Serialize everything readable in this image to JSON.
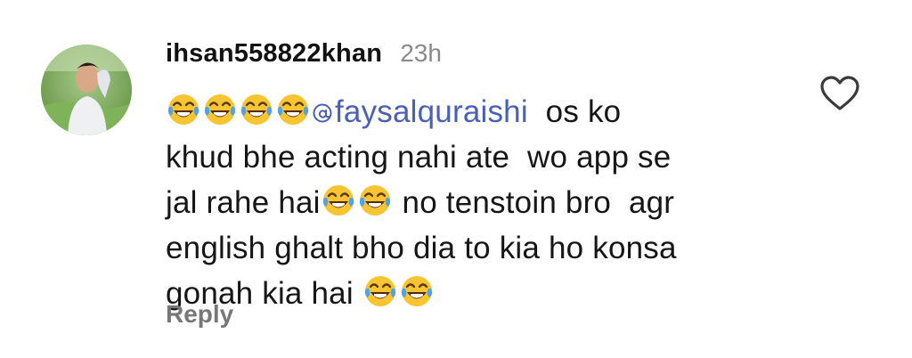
{
  "comment": {
    "username": "ihsan558822khan",
    "timestamp": "23h",
    "mention": "faysalquraishi",
    "lines": [
      [
        "emoji",
        "emoji",
        "emoji",
        "emoji",
        "mention",
        "  os ko"
      ],
      "khud bhe acting nahi ate  wo app se",
      [
        "jal rahe hai",
        "emoji",
        "emoji",
        " no tenstoin bro  agr"
      ],
      "english ghalt bho dia to kia ho konsa",
      [
        "gonah kia hai ",
        "emoji",
        "emoji"
      ]
    ],
    "text_segments": {
      "line1_after_mention": "  os ko",
      "line2": "khud bhe acting nahi ate  wo app se",
      "line3_before_emoji": "jal rahe hai",
      "line3_after_emoji": " no tenstoin bro  agr",
      "line4": "english ghalt bho dia to kia ho konsa",
      "line5_before_emoji": "gonah kia hai "
    },
    "emoji_name": "face-with-tears-of-joy",
    "reply_label": "Reply",
    "like_icon": "heart-outline-icon",
    "mention_icon": "threads-at-icon"
  },
  "colors": {
    "username": "#121212",
    "timestamp": "#8a8a8a",
    "mention": "#4a5fb8",
    "reply": "#777777",
    "heart": "#3a3a3a",
    "emoji_face": "#f7c531",
    "emoji_tears": "#4fa3e8"
  }
}
